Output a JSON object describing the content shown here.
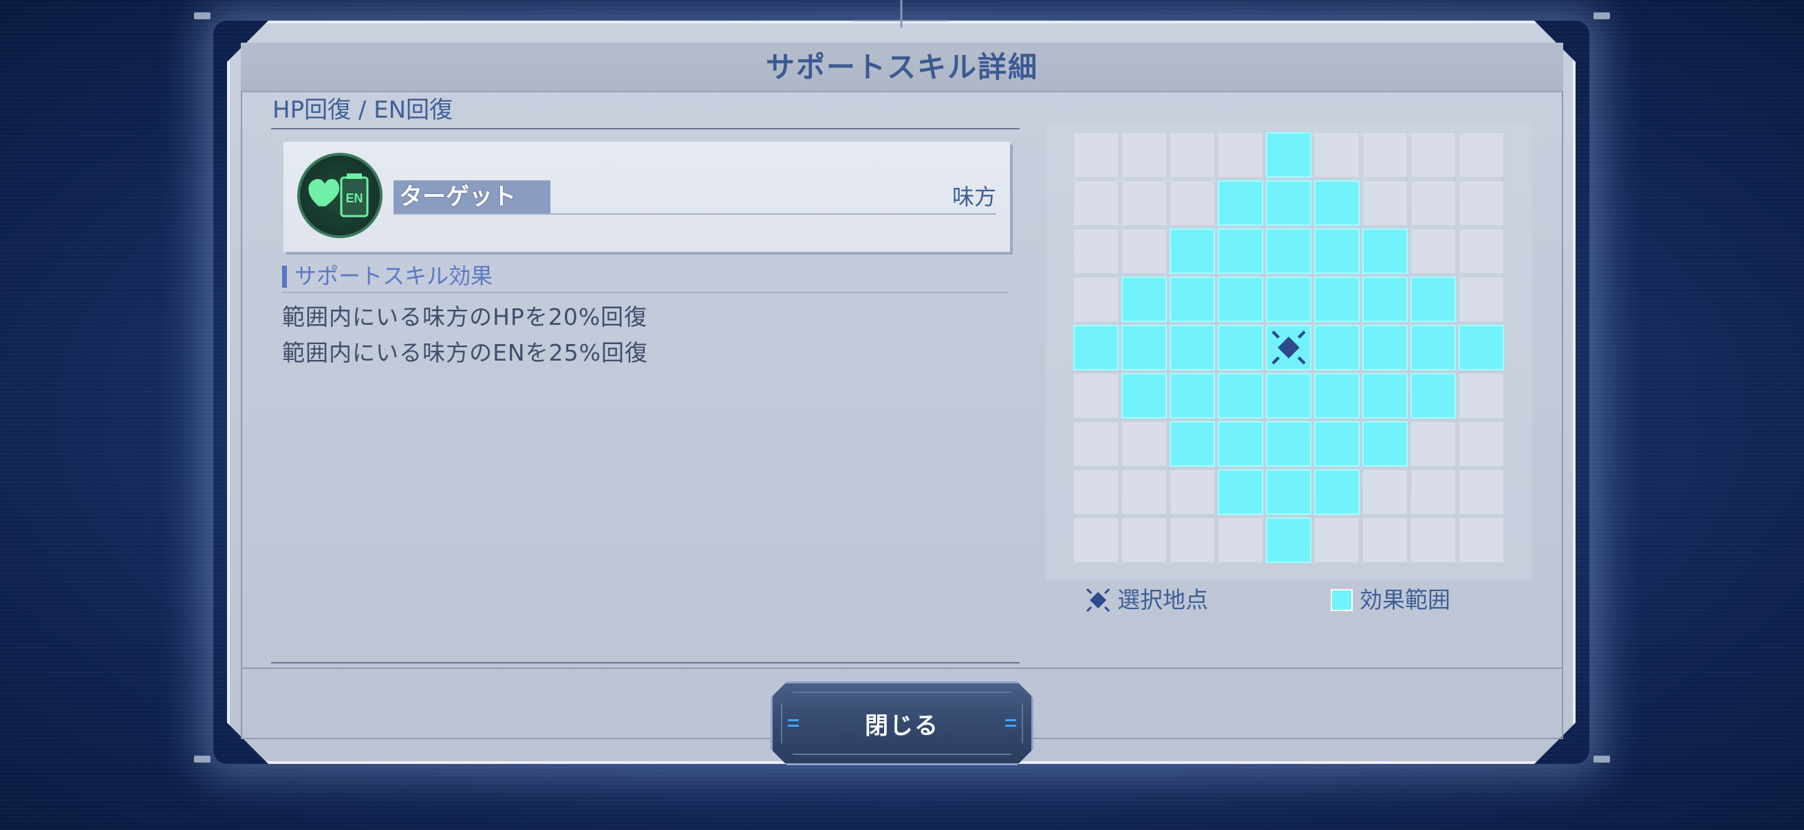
{
  "dialog": {
    "title": "サポートスキル詳細"
  },
  "skill": {
    "name": "HP回復 / EN回復",
    "icon": "heart-en-icon",
    "icon_badge": "EN",
    "target_label": "ターゲット",
    "target_value": "味方",
    "effect_heading": "サポートスキル効果",
    "effects": [
      "範囲内にいる味方のHPを20%回復",
      "範囲内にいる味方のENを25%回復"
    ]
  },
  "range_grid": {
    "columns": 9,
    "rows": 9,
    "center": [
      4,
      4
    ],
    "active_color": "#72f2fb",
    "pattern": [
      "....X....",
      "...XXX...",
      "..XXXXX..",
      ".XXXXXXX.",
      "XXXXXXXXX",
      ".XXXXXXX.",
      "..XXXXX..",
      "...XXX...",
      "....X...."
    ]
  },
  "legend": {
    "selected_point": "選択地点",
    "effect_range": "効果範囲"
  },
  "buttons": {
    "close": "閉じる"
  }
}
